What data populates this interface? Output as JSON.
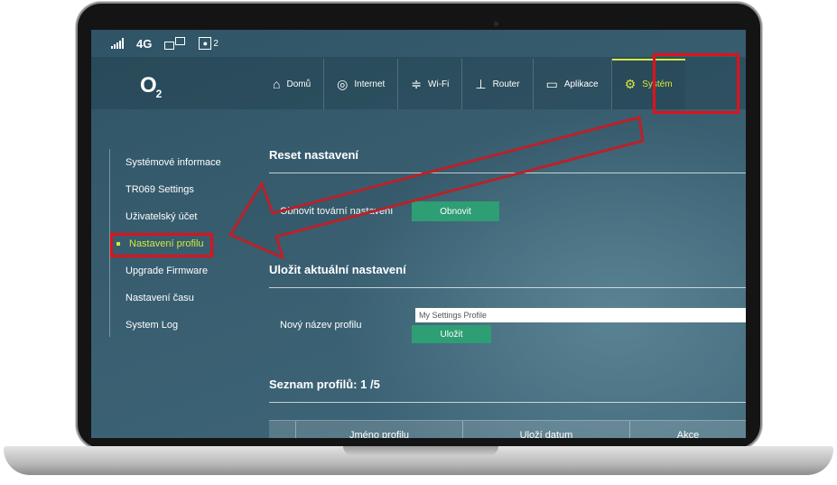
{
  "status": {
    "network": "4G",
    "users_count": "2"
  },
  "header": {
    "logo": "O",
    "logo_sub": "2",
    "nav": [
      {
        "label": "Domů",
        "icon": "home-icon"
      },
      {
        "label": "Internet",
        "icon": "globe-icon"
      },
      {
        "label": "Wi-Fi",
        "icon": "wifi-icon"
      },
      {
        "label": "Router",
        "icon": "router-icon"
      },
      {
        "label": "Aplikace",
        "icon": "monitor-icon"
      },
      {
        "label": "Systém",
        "icon": "gears-icon"
      }
    ],
    "active_nav": "Systém"
  },
  "sidebar": {
    "items": [
      {
        "label": "Systémové informace"
      },
      {
        "label": "TR069 Settings"
      },
      {
        "label": "Uživatelský účet"
      },
      {
        "label": "Nastavení profilu"
      },
      {
        "label": "Upgrade Firmware"
      },
      {
        "label": "Nastavení času"
      },
      {
        "label": "System Log"
      }
    ],
    "active_item": "Nastavení profilu"
  },
  "reset": {
    "title": "Reset nastavení",
    "label": "Obnovit tovární nastavení",
    "button": "Obnovit"
  },
  "save": {
    "title": "Uložit aktuální nastavení",
    "label": "Nový název profilu",
    "input_value": "My Settings Profile",
    "button": "Uložit"
  },
  "profiles": {
    "title": "Seznam profilů: 1 /5",
    "columns": [
      "",
      "Jméno profilu",
      "Uloží datum",
      "Akce"
    ]
  },
  "colors": {
    "accent": "#d6e83a",
    "button": "#2e9e74",
    "highlight": "#e3101a",
    "background": "#385e70"
  }
}
